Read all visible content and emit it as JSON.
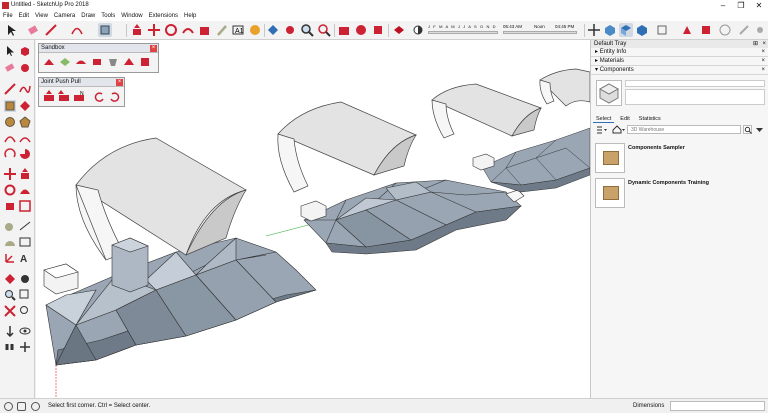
{
  "window": {
    "title": "Untitled - SketchUp Pro 2018"
  },
  "menu": [
    "File",
    "Edit",
    "View",
    "Camera",
    "Draw",
    "Tools",
    "Window",
    "Extensions",
    "Help"
  ],
  "shadow": {
    "months": "J F M A M J J A S O N D",
    "time_start": "05:43 AM",
    "time_mid": "Noon",
    "time_end": "04:45 PM"
  },
  "floating": {
    "sandbox_title": "Sandbox",
    "jpp_title": "Joint Push Pull"
  },
  "tray": {
    "title": "Default Tray",
    "sections": [
      "Entity Info",
      "Materials",
      "Components"
    ],
    "tabs": [
      "Select",
      "Edit",
      "Statistics"
    ],
    "search_placeholder": "3D Warehouse",
    "items": [
      "Components Sampler",
      "Dynamic Components Training"
    ]
  },
  "status": {
    "message": "Select first corner. Ctrl = Select center.",
    "dimensions_label": "Dimensions"
  },
  "colors": {
    "accent": "#2f6fb5",
    "terrain": "#98a4b2",
    "terrain_dark": "#5d6775",
    "close": "#e04343"
  }
}
